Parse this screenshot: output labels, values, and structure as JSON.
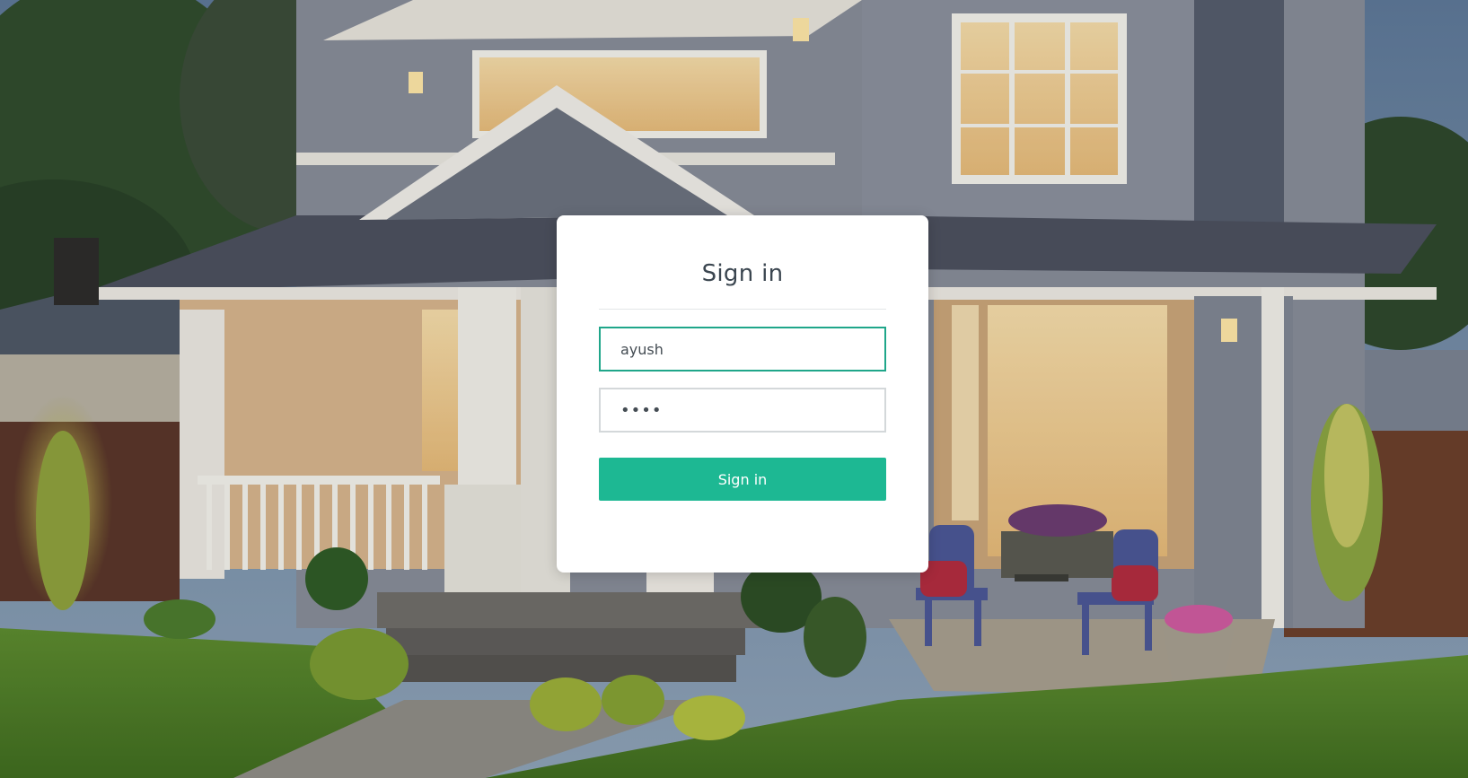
{
  "login": {
    "title": "Sign in",
    "username_value": "ayush",
    "password_value": "aaaa",
    "submit_label": "Sign in"
  },
  "colors": {
    "accent": "#1db893",
    "focus_border": "#1fa68a",
    "title_text": "#3b4650"
  },
  "background": {
    "icon": "house-photo-background"
  }
}
